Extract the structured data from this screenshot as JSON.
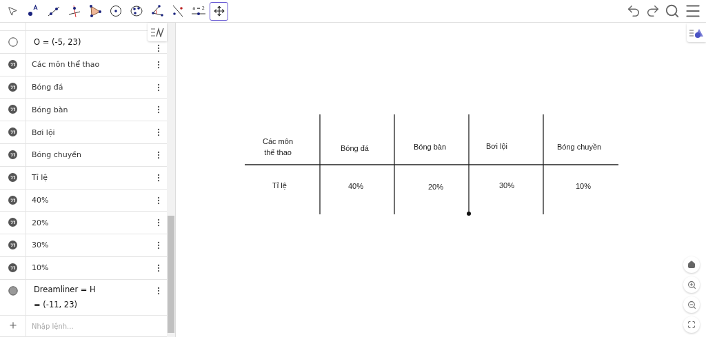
{
  "toolbar": {
    "tools": [
      {
        "kind": "move",
        "selected": false
      },
      {
        "kind": "point",
        "selected": false
      },
      {
        "kind": "line",
        "selected": false
      },
      {
        "kind": "perpendicular",
        "selected": false
      },
      {
        "kind": "polygon",
        "selected": false
      },
      {
        "kind": "circle",
        "selected": false
      },
      {
        "kind": "ellipse",
        "selected": false
      },
      {
        "kind": "angle",
        "selected": false
      },
      {
        "kind": "reflect",
        "selected": false
      },
      {
        "kind": "slider",
        "label": "a = 2",
        "selected": false
      },
      {
        "kind": "move_view",
        "selected": true
      }
    ]
  },
  "algebra": {
    "items": [
      {
        "kind": "point",
        "visible": false,
        "text": "O = (-5, 23)"
      },
      {
        "kind": "text",
        "text": "Các môn thể thao"
      },
      {
        "kind": "text",
        "text": "Bóng đá"
      },
      {
        "kind": "text",
        "text": "Bóng bàn"
      },
      {
        "kind": "text",
        "text": "Bơi lội"
      },
      {
        "kind": "text",
        "text": "Bóng chuyền"
      },
      {
        "kind": "text",
        "text": "Tỉ lệ"
      },
      {
        "kind": "text",
        "text": "40%"
      },
      {
        "kind": "text",
        "text": "20%"
      },
      {
        "kind": "text",
        "text": "30%"
      },
      {
        "kind": "text",
        "text": "10%"
      },
      {
        "kind": "point",
        "visible": true,
        "text": "Dreamliner = H",
        "value": "= (-11, 23)"
      }
    ],
    "input": {
      "placeholder": "Nhập lệnh..."
    }
  },
  "canvas": {
    "texts": [
      {
        "lines": [
          "Các môn",
          "thể thao"
        ]
      },
      {
        "lines": [
          "Bóng đá"
        ]
      },
      {
        "lines": [
          "Bóng bàn"
        ]
      },
      {
        "lines": [
          "Bơi lội"
        ]
      },
      {
        "lines": [
          "Bóng chuyền"
        ]
      },
      {
        "lines": [
          "Tỉ lệ"
        ]
      },
      {
        "lines": [
          "40%"
        ]
      },
      {
        "lines": [
          "20%"
        ]
      },
      {
        "lines": [
          "30%"
        ]
      },
      {
        "lines": [
          "10%"
        ]
      }
    ]
  }
}
